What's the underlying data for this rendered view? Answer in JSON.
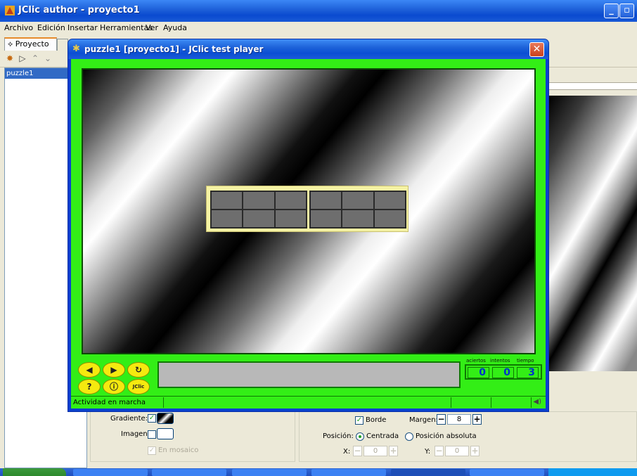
{
  "main_window": {
    "title": "JClic author - proyecto1",
    "menu": [
      "Archivo",
      "Edición",
      "Insertar",
      "Herramientas",
      "Ver",
      "Ayuda"
    ],
    "tab_label": "Proyecto",
    "tree_item": "puzzle1"
  },
  "player": {
    "title": "puzzle1 [proyecto1] - JClic test player",
    "counters": {
      "labels": [
        "aciertos",
        "intentos",
        "tiempo"
      ],
      "values": [
        "0",
        "0",
        "3"
      ]
    },
    "status_text": "Actividad en marcha",
    "buttons": {
      "help": "?",
      "info": "ⓘ",
      "jclic": "JClic"
    }
  },
  "settings": {
    "gradient_label": "Gradiente:",
    "image_label": "Imagen:",
    "tile_label": "En mosaico",
    "border_label": "Borde",
    "margin_label": "Margen:",
    "margin_value": "8",
    "position_label": "Posición:",
    "centered_label": "Centrada",
    "absolute_label": "Posición absoluta",
    "x_label": "X:",
    "x_value": "0",
    "y_label": "Y:",
    "y_value": "0"
  }
}
